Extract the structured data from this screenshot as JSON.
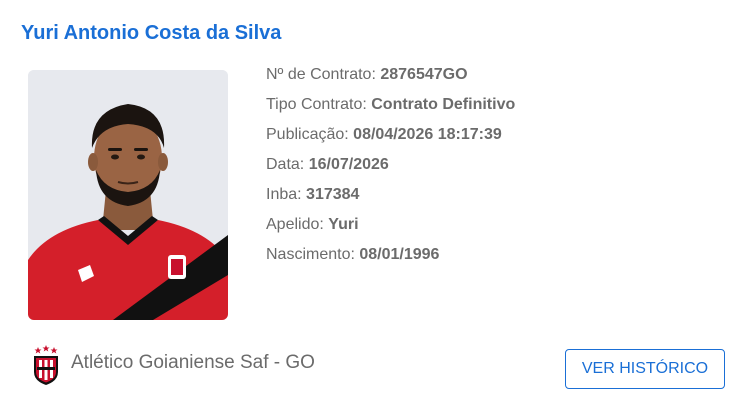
{
  "player": {
    "name": "Yuri Antonio Costa da Silva"
  },
  "details": [
    {
      "label": "Nº de Contrato:",
      "value": "2876547GO"
    },
    {
      "label": "Tipo Contrato:",
      "value": "Contrato Definitivo"
    },
    {
      "label": "Publicação:",
      "value": "08/04/2026 18:17:39"
    },
    {
      "label": "Data:",
      "value": "16/07/2026"
    },
    {
      "label": "Inba:",
      "value": "317384"
    },
    {
      "label": "Apelido:",
      "value": "Yuri"
    },
    {
      "label": "Nascimento:",
      "value": "08/01/1996"
    }
  ],
  "club": {
    "name": "Atlético Goianiense Saf - GO",
    "logo_icon": "club-crest-icon",
    "colors": {
      "primary": "#c8102e",
      "secondary": "#000000"
    }
  },
  "actions": {
    "history_label": "VER HISTÓRICO"
  },
  "colors": {
    "accent": "#1a6fd6",
    "text": "#6b6b6b"
  }
}
